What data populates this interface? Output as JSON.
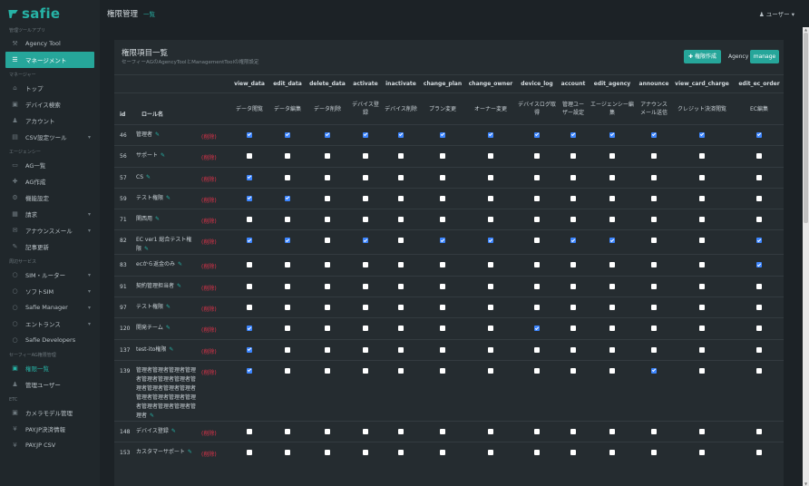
{
  "brand": {
    "logo_text": "safie"
  },
  "sidebar": {
    "sections": [
      {
        "title": "管理ツールアプリ",
        "items": [
          {
            "label": "Agency Tool",
            "icon": "tools-icon",
            "arrow": false,
            "state": ""
          },
          {
            "label": "マネージメント",
            "icon": "list-icon",
            "arrow": false,
            "state": "active"
          }
        ]
      },
      {
        "title": "マネージャー",
        "items": [
          {
            "label": "トップ",
            "icon": "home-icon",
            "arrow": false,
            "state": ""
          },
          {
            "label": "デバイス検索",
            "icon": "camera-icon",
            "arrow": false,
            "state": ""
          },
          {
            "label": "アカウント",
            "icon": "user-icon",
            "arrow": false,
            "state": ""
          },
          {
            "label": "CSV設定ツール",
            "icon": "file-icon",
            "arrow": true,
            "state": ""
          }
        ]
      },
      {
        "title": "エージェンシー",
        "items": [
          {
            "label": "AG一覧",
            "icon": "inbox-icon",
            "arrow": false,
            "state": ""
          },
          {
            "label": "AG作成",
            "icon": "plus-icon",
            "arrow": false,
            "state": ""
          },
          {
            "label": "機能設定",
            "icon": "gears-icon",
            "arrow": false,
            "state": ""
          },
          {
            "label": "請求",
            "icon": "invoice-icon",
            "arrow": true,
            "state": ""
          },
          {
            "label": "アナウンスメール",
            "icon": "mail-icon",
            "arrow": true,
            "state": ""
          },
          {
            "label": "記事更新",
            "icon": "edit-icon",
            "arrow": false,
            "state": ""
          }
        ]
      },
      {
        "title": "周辺サービス",
        "items": [
          {
            "label": "SIM・ルーター",
            "icon": "circle-icon",
            "arrow": true,
            "state": ""
          },
          {
            "label": "ソフトSIM",
            "icon": "circle-icon",
            "arrow": true,
            "state": ""
          },
          {
            "label": "Safie Manager",
            "icon": "circle-icon",
            "arrow": true,
            "state": ""
          },
          {
            "label": "エントランス",
            "icon": "circle-icon",
            "arrow": true,
            "state": ""
          },
          {
            "label": "Safie Developers",
            "icon": "circle-icon",
            "arrow": false,
            "state": ""
          }
        ]
      },
      {
        "title": "セーフィーAG権限管理",
        "items": [
          {
            "label": "権限一覧",
            "icon": "lock-icon",
            "arrow": false,
            "state": "current"
          },
          {
            "label": "管理ユーザー",
            "icon": "user-icon",
            "arrow": false,
            "state": ""
          }
        ]
      },
      {
        "title": "ETC",
        "items": [
          {
            "label": "カメラモデル管理",
            "icon": "camera-icon",
            "arrow": false,
            "state": ""
          },
          {
            "label": "PAY.JP決済情報",
            "icon": "yen-icon",
            "arrow": false,
            "state": ""
          },
          {
            "label": "PAY.JP CSV",
            "icon": "yen-icon",
            "arrow": false,
            "state": ""
          }
        ]
      }
    ]
  },
  "header": {
    "title": "権限管理",
    "subtitle": "一覧",
    "user_label": "ユーザー"
  },
  "card": {
    "title": "権限項目一覧",
    "subtitle": "セーフィーAGのAgencyToolとManagementToolの権限設定",
    "create_button": "権限作成",
    "agency_button": "Agency",
    "manage_button": "manage"
  },
  "table": {
    "id_header": "id",
    "role_header": "ロール名",
    "delete_label": "(削除)",
    "columns": [
      {
        "key": "view_data",
        "label": "データ閲覧"
      },
      {
        "key": "edit_data",
        "label": "データ編集"
      },
      {
        "key": "delete_data",
        "label": "データ削除"
      },
      {
        "key": "activate",
        "label": "デバイス登録"
      },
      {
        "key": "inactivate",
        "label": "デバイス削除"
      },
      {
        "key": "change_plan",
        "label": "プラン変更"
      },
      {
        "key": "change_owner",
        "label": "オーナー変更"
      },
      {
        "key": "device_log",
        "label": "デバイスログ取得"
      },
      {
        "key": "account",
        "label": "管理ユーザー設定"
      },
      {
        "key": "edit_agency",
        "label": "エージェンシー編集"
      },
      {
        "key": "announce",
        "label": "アナウンスメール送信"
      },
      {
        "key": "view_card_charge",
        "label": "クレジット決済閲覧"
      },
      {
        "key": "edit_ec_order",
        "label": "EC編集"
      }
    ],
    "rows": [
      {
        "id": "46",
        "name": "管理者",
        "checks": [
          1,
          1,
          1,
          1,
          1,
          1,
          1,
          1,
          1,
          1,
          1,
          1,
          1
        ]
      },
      {
        "id": "56",
        "name": "サポート",
        "checks": [
          0,
          0,
          0,
          0,
          0,
          0,
          0,
          0,
          0,
          0,
          0,
          0,
          0
        ]
      },
      {
        "id": "57",
        "name": "CS",
        "checks": [
          1,
          0,
          0,
          0,
          0,
          0,
          0,
          0,
          0,
          0,
          0,
          0,
          0
        ]
      },
      {
        "id": "59",
        "name": "テスト権限",
        "checks": [
          1,
          1,
          0,
          0,
          0,
          0,
          0,
          0,
          0,
          0,
          0,
          0,
          0
        ]
      },
      {
        "id": "71",
        "name": "関西用",
        "checks": [
          0,
          0,
          0,
          0,
          0,
          0,
          0,
          0,
          0,
          0,
          0,
          0,
          0
        ]
      },
      {
        "id": "82",
        "name": "EC ver1 総合テスト権限",
        "checks": [
          1,
          1,
          0,
          1,
          0,
          1,
          1,
          0,
          1,
          1,
          0,
          0,
          1
        ]
      },
      {
        "id": "83",
        "name": "ecから返金のみ",
        "checks": [
          0,
          0,
          0,
          0,
          0,
          0,
          0,
          0,
          0,
          0,
          0,
          0,
          1
        ]
      },
      {
        "id": "91",
        "name": "契約管理担当者",
        "checks": [
          0,
          0,
          0,
          0,
          0,
          0,
          0,
          0,
          0,
          0,
          0,
          0,
          0
        ]
      },
      {
        "id": "97",
        "name": "テスト権限",
        "checks": [
          0,
          0,
          0,
          0,
          0,
          0,
          0,
          0,
          0,
          0,
          0,
          0,
          0
        ]
      },
      {
        "id": "120",
        "name": "開発チーム",
        "checks": [
          1,
          0,
          0,
          0,
          0,
          0,
          0,
          1,
          0,
          0,
          0,
          0,
          0
        ]
      },
      {
        "id": "137",
        "name": "test-ito権限",
        "checks": [
          1,
          0,
          0,
          0,
          0,
          0,
          0,
          0,
          0,
          0,
          0,
          0,
          0
        ]
      },
      {
        "id": "139",
        "name": "管理者管理者管理者管理者管理者管理者管理者管理者管理者管理者管理者管理者管理者管理者管理者管理者管理者管理者管理者",
        "checks": [
          1,
          0,
          0,
          0,
          0,
          0,
          0,
          0,
          0,
          0,
          1,
          0,
          0
        ]
      },
      {
        "id": "148",
        "name": "デバイス登録",
        "checks": [
          0,
          0,
          0,
          0,
          0,
          0,
          0,
          0,
          0,
          0,
          0,
          0,
          0
        ]
      },
      {
        "id": "153",
        "name": "カスタマーサポート",
        "checks": [
          0,
          0,
          0,
          0,
          0,
          0,
          0,
          0,
          0,
          0,
          0,
          0,
          0
        ]
      }
    ]
  },
  "colors": {
    "accent": "#26a69a",
    "danger": "#e0334a",
    "checked": "#3d86ff"
  }
}
